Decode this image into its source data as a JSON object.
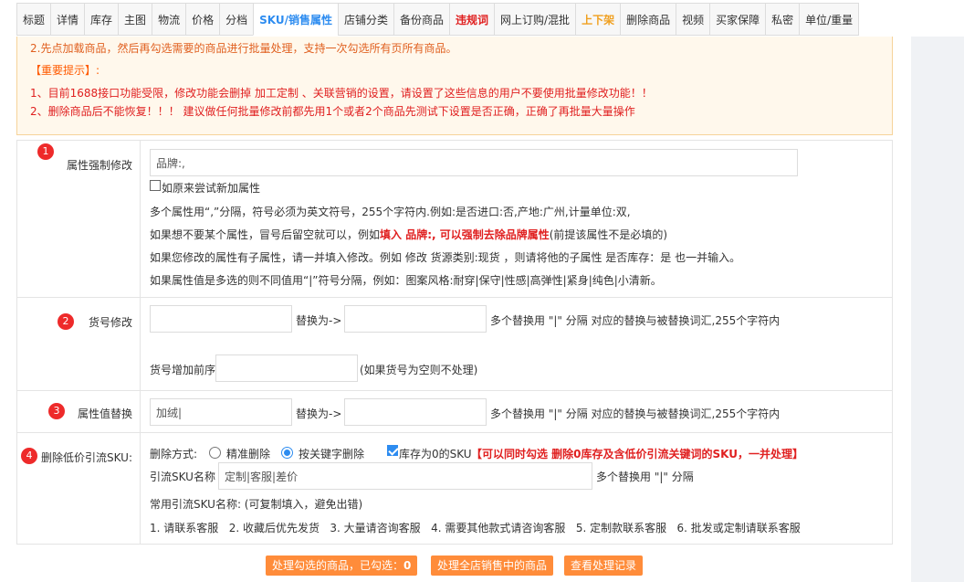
{
  "tabs": [
    {
      "label": "标题"
    },
    {
      "label": "详情"
    },
    {
      "label": "库存"
    },
    {
      "label": "主图"
    },
    {
      "label": "物流"
    },
    {
      "label": "价格"
    },
    {
      "label": "分档"
    },
    {
      "label": "SKU/销售属性"
    },
    {
      "label": "店铺分类"
    },
    {
      "label": "备份商品"
    },
    {
      "label": "违规词"
    },
    {
      "label": "网上订购/混批"
    },
    {
      "label": "上下架"
    },
    {
      "label": "删除商品"
    },
    {
      "label": "视频"
    },
    {
      "label": "买家保障"
    },
    {
      "label": "私密"
    },
    {
      "label": "单位/重量"
    }
  ],
  "notice": {
    "line0": "2.先点加载商品，然后再勾选需要的商品进行批量处理，支持一次勾选所有页所有商品。",
    "tip_title": "【重要提示】:",
    "line1": "1、目前1688接口功能受限，修改功能会删掉 加工定制 、关联营销的设置，请设置了这些信息的用户不要使用批量修改功能！！",
    "line2": "2、删除商品后不能恢复！！！ 建议做任何批量修改前都先用1个或者2个商品先测试下设置是否正确，正确了再批量大量操作"
  },
  "attr": {
    "badge": "1",
    "label": "属性强制修改",
    "input_value": "品牌:,",
    "checkbox_label": "如原来尝试新加属性",
    "help1": "多个属性用“,”分隔，符号必须为英文符号，255个字符内.例如:是否进口:否,产地:广州,计量单位:双,",
    "help2_pre": "如果想不要某个属性，冒号后留空就可以，例如",
    "help2_red": "填入 品牌:, 可以强制去除品牌属性",
    "help2_post": "(前提该属性不是必填的)",
    "help3": "如果您修改的属性有子属性，请一并填入修改。例如 修改 货源类别:现货 ，则请将他的子属性 是否库存：是 也一并输入。",
    "help4": "如果属性值是多选的则不同值用“|”符号分隔，例如：图案风格:耐穿|保守|性感|高弹性|紧身|纯色|小清新。"
  },
  "sku_no": {
    "badge": "2",
    "label": "货号修改",
    "replace_label": "替换为->",
    "hint": "多个替换用 \"|\" 分隔 对应的替换与被替换词汇,255个字符内",
    "prefix_label": "货号增加前序",
    "prefix_hint": "(如果货号为空则不处理)"
  },
  "attr_replace": {
    "badge": "3",
    "label": "属性值替换",
    "input_value": "加绒|",
    "replace_label": "替换为->",
    "hint": "多个替换用 \"|\" 分隔 对应的替换与被替换词汇,255个字符内"
  },
  "low_price": {
    "badge": "4",
    "label": "删除低价引流SKU:",
    "method_label": "删除方式:",
    "radio1": "精准删除",
    "radio2": "按关键字删除",
    "checkbox_label": "库存为0的SKU",
    "red_note": "【可以同时勾选 删除0库存及含低价引流关键词的SKU，一并处理】",
    "name_label": "引流SKU名称",
    "name_value": "定制|客服|差价",
    "name_hint": "多个替换用 \"|\" 分隔",
    "common_label": "常用引流SKU名称: (可复制填入，避免出错)",
    "common_list": "1. 请联系客服   2. 收藏后优先发货   3. 大量请咨询客服   4. 需要其他款式请咨询客服   5. 定制款联系客服   6. 批发或定制请联系客服"
  },
  "buttons": {
    "process_selected": "处理勾选的商品，已勾选：",
    "selected_count": "0",
    "process_all": "处理全店销售中的商品",
    "view_log": "查看处理记录"
  }
}
